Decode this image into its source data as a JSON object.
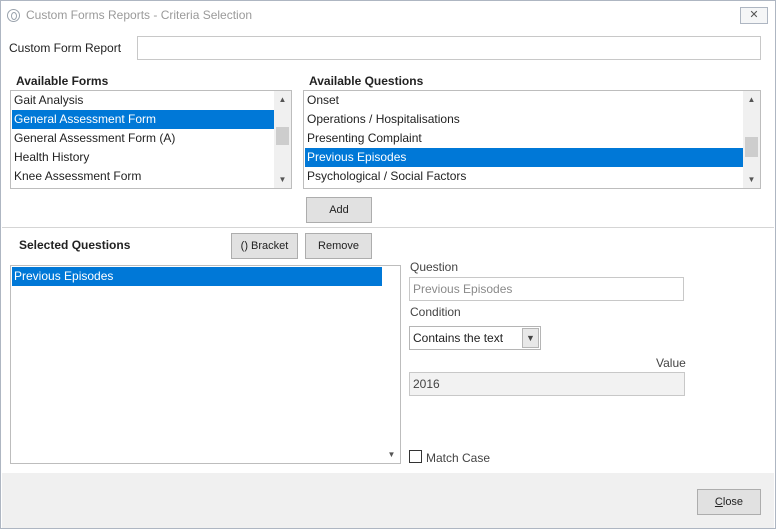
{
  "window": {
    "title": "Custom Forms Reports - Criteria Selection",
    "close_symbol": "✕"
  },
  "report": {
    "label": "Custom Form Report",
    "value": ""
  },
  "available_forms": {
    "heading": "Available Forms",
    "items": [
      "Gait Analysis",
      "General Assessment Form",
      "General Assessment Form (A)",
      "Health History",
      "Knee Assessment Form"
    ],
    "selected_index": 1
  },
  "available_questions": {
    "heading": "Available Questions",
    "items": [
      "Onset",
      "Operations / Hospitalisations",
      "Presenting Complaint",
      "Previous Episodes",
      "Psychological / Social Factors"
    ],
    "selected_index": 3
  },
  "buttons": {
    "add": "Add",
    "bracket": "() Bracket",
    "remove": "Remove",
    "close": "Close"
  },
  "selected_questions": {
    "heading": "Selected Questions",
    "items": [
      "Previous Episodes"
    ]
  },
  "criteria": {
    "question_label": "Question",
    "question_value": "Previous Episodes",
    "condition_label": "Condition",
    "condition_value": "Contains the text",
    "value_label": "Value",
    "value_value": "2016",
    "match_case_label": "Match Case",
    "match_case_checked": false
  },
  "icons": {
    "scroll_up": "▲",
    "scroll_down": "▼",
    "dropdown": "▼"
  }
}
